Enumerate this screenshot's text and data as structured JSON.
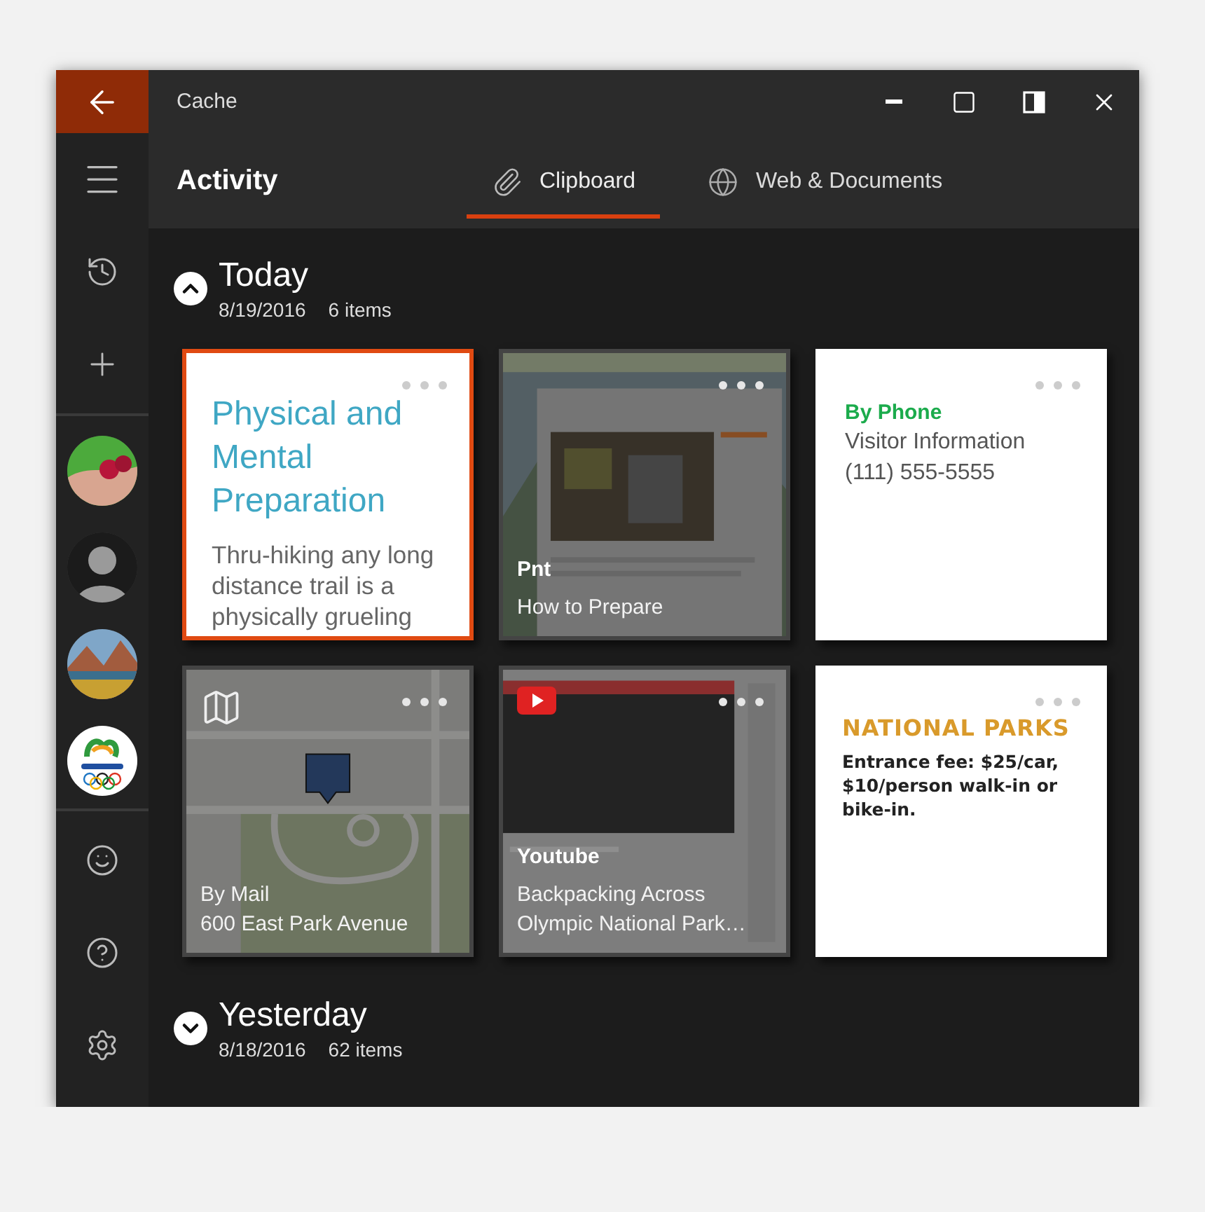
{
  "window": {
    "title": "Cache"
  },
  "header": {
    "title": "Activity"
  },
  "tabs": [
    {
      "label": "Clipboard",
      "selected": true
    },
    {
      "label": "Web & Documents",
      "selected": false
    }
  ],
  "avatars": [
    {
      "kind": "picture"
    },
    {
      "kind": "person"
    },
    {
      "kind": "picture"
    },
    {
      "kind": "logo"
    }
  ],
  "groups": [
    {
      "title": "Today",
      "date": "8/19/2016",
      "count": "6 items",
      "expanded": true,
      "cards": [
        {
          "kind": "note",
          "selected": true,
          "title": "Physical and Mental Preparation",
          "body": "Thru-hiking any long distance trail is a physically grueling"
        },
        {
          "kind": "web",
          "selected": false,
          "source": "Pnt",
          "lines": [
            "How to Prepare"
          ]
        },
        {
          "kind": "contact",
          "selected": false,
          "title": "By Phone",
          "lines": [
            "Visitor Information",
            "(111) 555-5555"
          ]
        },
        {
          "kind": "map",
          "selected": false,
          "lines": [
            "By Mail",
            "600 East Park Avenue"
          ]
        },
        {
          "kind": "video",
          "selected": false,
          "source": "Youtube",
          "lines": [
            "Backpacking Across",
            "Olympic National Park…"
          ]
        },
        {
          "kind": "text",
          "selected": false,
          "title": "NATIONAL PARKS",
          "body": "Entrance fee: $25/car, $10/person walk-in or bike-in."
        }
      ]
    },
    {
      "title": "Yesterday",
      "date": "8/18/2016",
      "count": "62 items",
      "expanded": false
    }
  ]
}
